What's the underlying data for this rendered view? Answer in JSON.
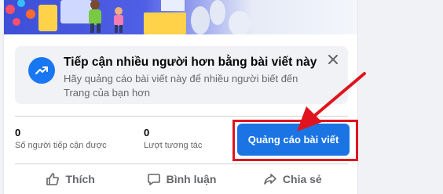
{
  "promo": {
    "title": "Tiếp cận nhiều người hơn bằng bài viết này",
    "description": "Hãy quảng cáo bài viết này để nhiều người biết đến Trang của bạn hơn",
    "icon": "trending-up-icon"
  },
  "stats": [
    {
      "value": "0",
      "label": "Số người tiếp cận được"
    },
    {
      "value": "0",
      "label": "Lượt tương tác"
    }
  ],
  "boost_button": {
    "label": "Quảng cáo bài viết"
  },
  "actions": [
    {
      "label": "Thích",
      "icon": "like-icon"
    },
    {
      "label": "Bình luận",
      "icon": "comment-icon"
    },
    {
      "label": "Chia sẻ",
      "icon": "share-icon"
    }
  ],
  "colors": {
    "accent": "#1b74e4",
    "highlight": "#e0141e",
    "muted_text": "#65676b",
    "promo_bg": "#f0f2f5"
  }
}
